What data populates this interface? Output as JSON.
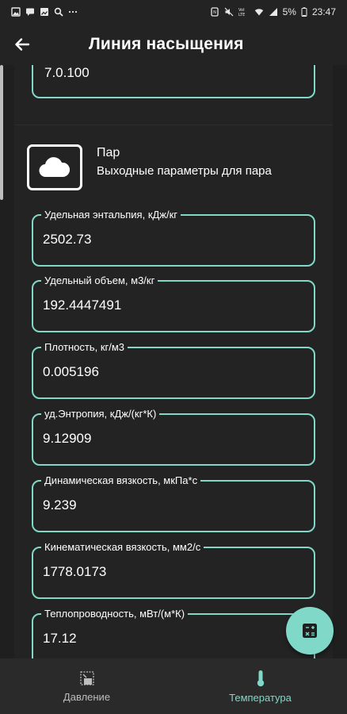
{
  "status_bar": {
    "battery": "5%",
    "time": "23:47"
  },
  "app_bar": {
    "title": "Линия насыщения"
  },
  "previous_field": {
    "value": "7.0.100"
  },
  "section": {
    "title": "Пар",
    "subtitle": "Выходные параметры для пара",
    "icon": "cloud-icon"
  },
  "fields": [
    {
      "label": "Удельная энтальпия, кДж/кг",
      "value": "2502.73"
    },
    {
      "label": "Удельный объем, м3/кг",
      "value": "192.4447491"
    },
    {
      "label": "Плотность, кг/м3",
      "value": "0.005196"
    },
    {
      "label": "уд.Энтропия, кДж/(кг*К)",
      "value": "9.12909"
    },
    {
      "label": "Динамическая вязкость, мкПа*с",
      "value": "9.239"
    },
    {
      "label": "Кинематическая вязкость, мм2/с",
      "value": "1778.0173"
    },
    {
      "label": "Теплопроводность, мВт/(м*К)",
      "value": "17.12"
    }
  ],
  "fab": {
    "icon": "calculator-icon"
  },
  "bottom_nav": {
    "items": [
      {
        "label": "Давление",
        "icon": "pressure-icon",
        "active": false
      },
      {
        "label": "Температура",
        "icon": "thermometer-icon",
        "active": true
      }
    ]
  },
  "colors": {
    "accent": "#7fd8c8",
    "background": "#232323",
    "nav_background": "#2a2a2a"
  }
}
